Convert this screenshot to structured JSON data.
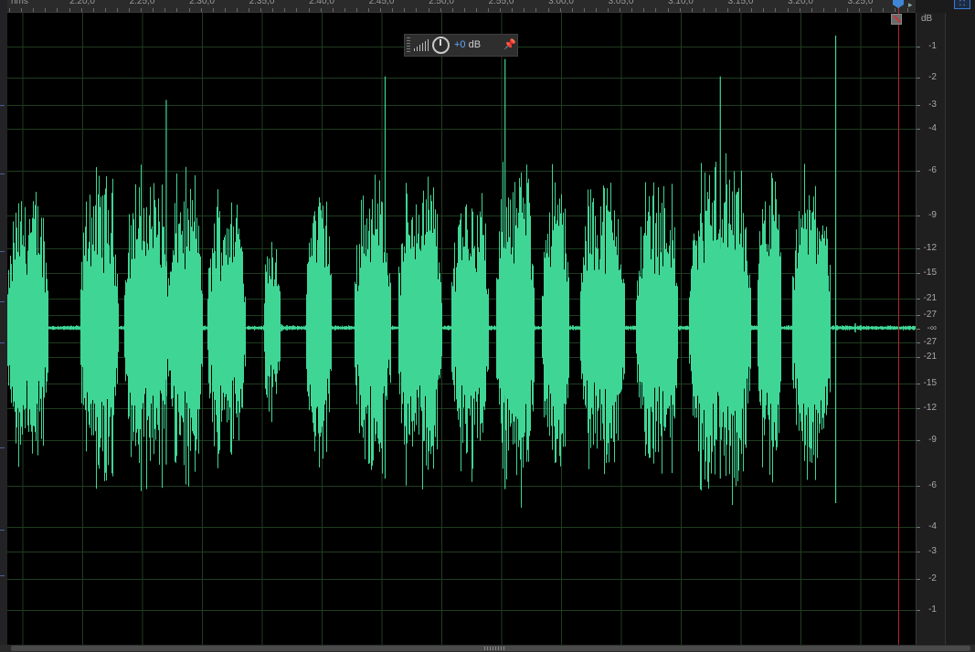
{
  "ruler": {
    "unit": "hms",
    "labels": [
      "2:20,0",
      "2:25,0",
      "2:30,0",
      "2:35,0",
      "2:40,0",
      "2:45,0",
      "2:50,0",
      "2:55,0",
      "3:00,0",
      "3:05,0",
      "3:10,0",
      "3:15,0",
      "3:20,0",
      "3:25,0"
    ]
  },
  "hud": {
    "value_num": "+0",
    "value_unit": " dB",
    "knob_icon": "knob-icon",
    "meter_icon": "level-bars-icon",
    "pin_icon": "pin-icon"
  },
  "db_scale": {
    "unit": "dB",
    "labels": [
      "-1",
      "-2",
      "-3",
      "-4",
      "-6",
      "-9",
      "-12",
      "-15",
      "-21",
      "-27",
      "-∞",
      "-27",
      "-21",
      "-15",
      "-12",
      "-9",
      "-6",
      "-4",
      "-3",
      "-2",
      "-1"
    ]
  },
  "colors": {
    "waveform": "#3fd695",
    "grid": "#1f3d1f",
    "playhead": "#b22a2a",
    "accent": "#3f86d6",
    "background": "#000000"
  },
  "waveform": {
    "bursts": [
      {
        "start": 0.0,
        "end": 0.045,
        "amp": 0.55
      },
      {
        "start": 0.08,
        "end": 0.122,
        "amp": 0.62
      },
      {
        "start": 0.128,
        "end": 0.178,
        "amp": 0.62
      },
      {
        "start": 0.178,
        "end": 0.215,
        "amp": 0.6
      },
      {
        "start": 0.22,
        "end": 0.262,
        "amp": 0.55
      },
      {
        "start": 0.282,
        "end": 0.3,
        "amp": 0.4
      },
      {
        "start": 0.328,
        "end": 0.357,
        "amp": 0.58
      },
      {
        "start": 0.382,
        "end": 0.422,
        "amp": 0.62
      },
      {
        "start": 0.43,
        "end": 0.478,
        "amp": 0.62
      },
      {
        "start": 0.488,
        "end": 0.53,
        "amp": 0.58
      },
      {
        "start": 0.538,
        "end": 0.58,
        "amp": 0.68
      },
      {
        "start": 0.588,
        "end": 0.618,
        "amp": 0.62
      },
      {
        "start": 0.63,
        "end": 0.68,
        "amp": 0.6
      },
      {
        "start": 0.692,
        "end": 0.738,
        "amp": 0.6
      },
      {
        "start": 0.75,
        "end": 0.818,
        "amp": 0.68
      },
      {
        "start": 0.825,
        "end": 0.852,
        "amp": 0.62
      },
      {
        "start": 0.864,
        "end": 0.906,
        "amp": 0.62
      }
    ],
    "spikes": [
      {
        "pos": 0.175,
        "amp": 0.78
      },
      {
        "pos": 0.416,
        "amp": 0.86
      },
      {
        "pos": 0.548,
        "amp": 0.92
      },
      {
        "pos": 0.785,
        "amp": 0.86
      },
      {
        "pos": 0.912,
        "amp": 1.0
      }
    ]
  }
}
